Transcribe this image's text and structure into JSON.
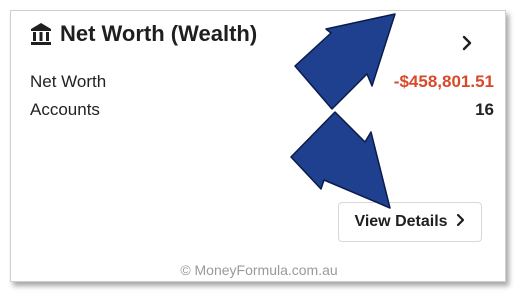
{
  "card": {
    "title": "Net Worth (Wealth)",
    "icon": "bank-icon",
    "rows": [
      {
        "label": "Net Worth",
        "value": "-$458,801.51"
      },
      {
        "label": "Accounts",
        "value": "16"
      }
    ],
    "details_button": "View Details",
    "details_chevron": ">",
    "header_chevron": ">"
  },
  "watermark": "© MoneyFormula.com.au",
  "colors": {
    "negative_value": "#d94a2b",
    "arrow_fill": "#1f3f8f",
    "arrow_stroke": "#0b1c4a"
  }
}
